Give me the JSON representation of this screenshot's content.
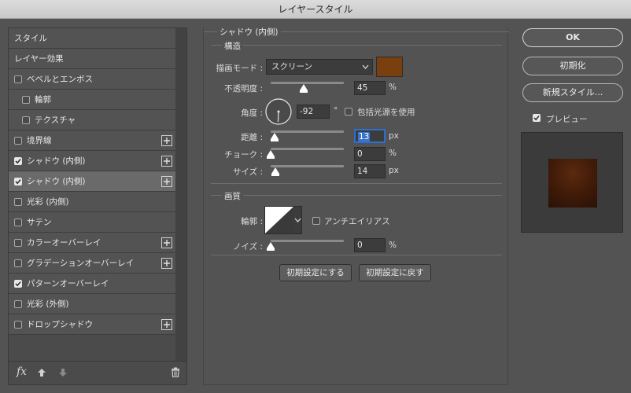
{
  "window": {
    "title": "レイヤースタイル"
  },
  "left": {
    "items": [
      {
        "label": "スタイル",
        "checkbox": false,
        "checked": false,
        "plus": false,
        "indent": 0,
        "active": false
      },
      {
        "label": "レイヤー効果",
        "checkbox": false,
        "checked": false,
        "plus": false,
        "indent": 0,
        "active": false
      },
      {
        "label": "ベベルとエンボス",
        "checkbox": true,
        "checked": false,
        "plus": false,
        "indent": 0,
        "active": false
      },
      {
        "label": "輪郭",
        "checkbox": true,
        "checked": false,
        "plus": false,
        "indent": 1,
        "active": false
      },
      {
        "label": "テクスチャ",
        "checkbox": true,
        "checked": false,
        "plus": false,
        "indent": 1,
        "active": false
      },
      {
        "label": "境界線",
        "checkbox": true,
        "checked": false,
        "plus": true,
        "indent": 0,
        "active": false
      },
      {
        "label": "シャドウ (内側)",
        "checkbox": true,
        "checked": true,
        "plus": true,
        "indent": 0,
        "active": false
      },
      {
        "label": "シャドウ (内側)",
        "checkbox": true,
        "checked": true,
        "plus": true,
        "indent": 0,
        "active": true
      },
      {
        "label": "光彩 (内側)",
        "checkbox": true,
        "checked": false,
        "plus": false,
        "indent": 0,
        "active": false
      },
      {
        "label": "サテン",
        "checkbox": true,
        "checked": false,
        "plus": false,
        "indent": 0,
        "active": false
      },
      {
        "label": "カラーオーバーレイ",
        "checkbox": true,
        "checked": false,
        "plus": true,
        "indent": 0,
        "active": false
      },
      {
        "label": "グラデーションオーバーレイ",
        "checkbox": true,
        "checked": false,
        "plus": true,
        "indent": 0,
        "active": false
      },
      {
        "label": "パターンオーバーレイ",
        "checkbox": true,
        "checked": true,
        "plus": false,
        "indent": 0,
        "active": false
      },
      {
        "label": "光彩 (外側)",
        "checkbox": true,
        "checked": false,
        "plus": false,
        "indent": 0,
        "active": false
      },
      {
        "label": "ドロップシャドウ",
        "checkbox": true,
        "checked": false,
        "plus": true,
        "indent": 0,
        "active": false
      }
    ],
    "footer": {
      "fx_label": "fx",
      "icons": [
        "fx-icon",
        "move-up-icon",
        "move-down-icon",
        "trash-icon"
      ]
    }
  },
  "panel": {
    "title": "シャドウ (内側)",
    "structure": {
      "title": "構造",
      "blend_mode_label": "描画モード :",
      "blend_mode_value": "スクリーン",
      "color": "#7a3f0e",
      "opacity_label": "不透明度 :",
      "opacity_value": "45",
      "opacity_unit": "%",
      "opacity_fraction": 0.45,
      "angle_label": "角度 :",
      "angle_value": "-92",
      "angle_unit": "°",
      "global_light_label": "包括光源を使用",
      "global_light_checked": false,
      "distance_label": "距離 :",
      "distance_value": "13",
      "distance_unit": "px",
      "distance_fraction": 0.05,
      "choke_label": "チョーク :",
      "choke_value": "0",
      "choke_unit": "%",
      "choke_fraction": 0.0,
      "size_label": "サイズ :",
      "size_value": "14",
      "size_unit": "px",
      "size_fraction": 0.06
    },
    "quality": {
      "title": "画質",
      "contour_label": "輪郭 :",
      "antialias_label": "アンチエイリアス",
      "antialias_checked": false,
      "noise_label": "ノイズ :",
      "noise_value": "0",
      "noise_unit": "%",
      "noise_fraction": 0.0
    },
    "buttons": {
      "make_default": "初期設定にする",
      "reset_default": "初期設定に戻す"
    }
  },
  "right": {
    "ok": "OK",
    "reset": "初期化",
    "new_style": "新規スタイル...",
    "preview_label": "プレビュー",
    "preview_checked": true
  }
}
